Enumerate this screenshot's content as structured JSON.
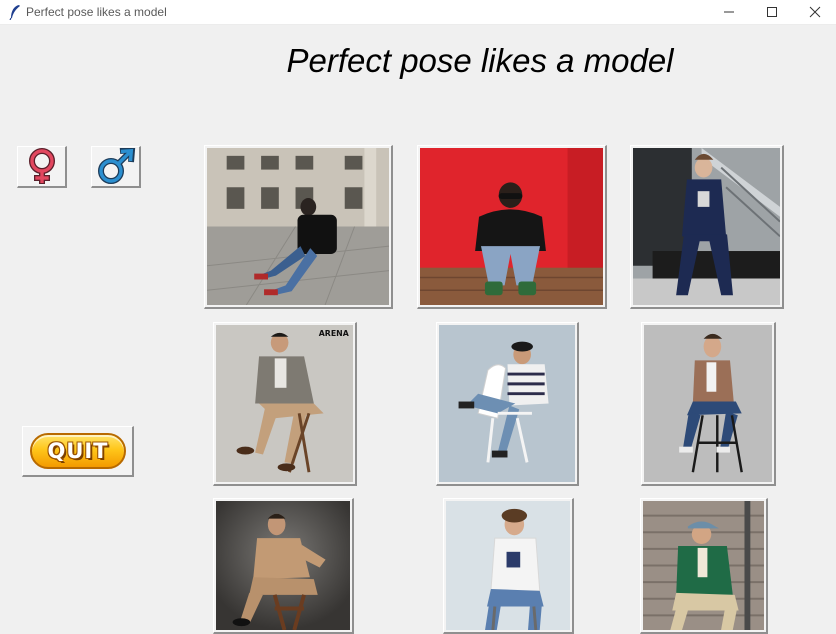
{
  "window": {
    "title": "Perfect pose likes a model",
    "controls": [
      "minimize",
      "maximize",
      "close"
    ]
  },
  "heading": "Perfect pose likes a model",
  "gender_buttons": [
    {
      "name": "female",
      "icon": "female-symbol-icon",
      "color": "#e2475f"
    },
    {
      "name": "male",
      "icon": "male-symbol-icon",
      "color": "#2b8fd0"
    }
  ],
  "quit_button": {
    "label": "QUIT"
  },
  "photos": [
    {
      "row": 1,
      "col": 1,
      "scene": "man in black t-shirt and jeans sitting on stone plaza before a building"
    },
    {
      "row": 1,
      "col": 2,
      "scene": "man in sunglasses sitting against a red wall"
    },
    {
      "row": 1,
      "col": 3,
      "scene": "man in navy suit sitting on a bench by a glass staircase"
    },
    {
      "row": 2,
      "col": 1,
      "scene": "man in grey blazer and beige trousers seated, magazine mark",
      "watermark": "ARENA"
    },
    {
      "row": 2,
      "col": 2,
      "scene": "man in striped shirt sitting on a white chair"
    },
    {
      "row": 2,
      "col": 3,
      "scene": "man in brown jacket sitting on a tall stool"
    },
    {
      "row": 3,
      "col": 1,
      "scene": "man in tan turtleneck sitting on a stool, dark backdrop"
    },
    {
      "row": 3,
      "col": 2,
      "scene": "man in white sweater sitting on a stool"
    },
    {
      "row": 3,
      "col": 3,
      "scene": "man in green jacket and cap sitting on stone steps"
    }
  ]
}
